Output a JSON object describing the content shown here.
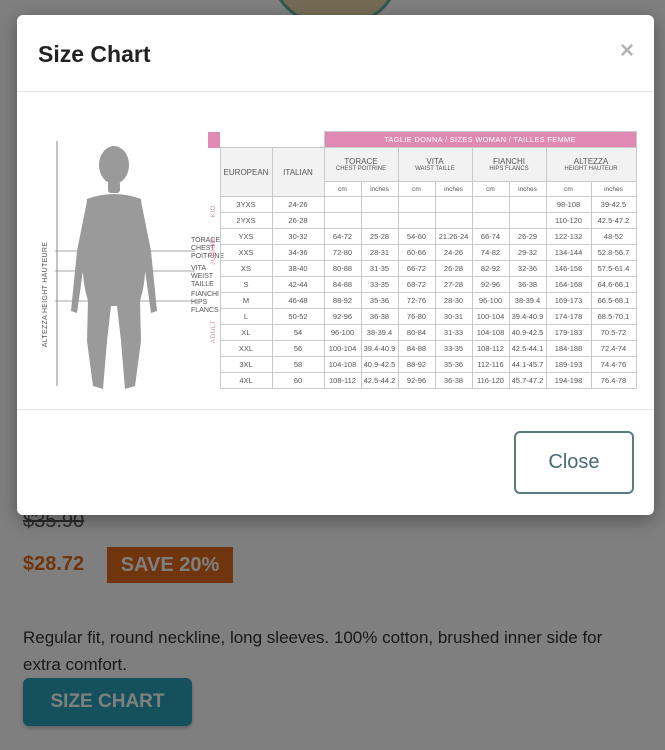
{
  "background": {
    "old_price": "$35.90",
    "new_price": "$28.72",
    "save_badge": "SAVE 20%",
    "description": "Regular fit, round neckline, long sleeves. 100% cotton, brushed inner side for extra comfort.",
    "size_chart_button": "SIZE CHART"
  },
  "modal": {
    "title": "Size Chart",
    "close_icon": "×",
    "close_button": "Close"
  },
  "chart": {
    "table_title": "TAGLIE  DONNA  / SIZES WOMAN / TAILLES FEMME",
    "altezza_label": "ALTEZZA HEIGHT HAUTEURE",
    "body_labels": {
      "torace": [
        "TORACE",
        "CHEST",
        "POITRINE"
      ],
      "vita": [
        "VITA",
        "WEIST",
        "TAILLE"
      ],
      "fianchi": [
        "FIANCHI",
        "HIPS",
        "FLANCS"
      ]
    },
    "headers": {
      "european": "EUROPEAN",
      "italian": "ITALIAN",
      "torace": "TORACE",
      "torace_sub": "CHEST\nPOITRINE",
      "vita": "VITA",
      "vita_sub": "WAIST\nTAILLE",
      "fianchi": "FIANCHI",
      "fianchi_sub": "HIPS\nFLANCS",
      "altezza": "ALTEZZA",
      "altezza_sub": "HEIGHT HAUTEUR",
      "cm": "cm",
      "inches": "inches"
    },
    "groups": {
      "kid": "KID",
      "junior": "JUNIOR",
      "adult": "ADULT"
    },
    "rows_kid": [
      [
        "3YXS",
        "24-26",
        "",
        "",
        "",
        "",
        "",
        "",
        "98-108",
        "39-42.5"
      ],
      [
        "2YXS",
        "26-28",
        "",
        "",
        "",
        "",
        "",
        "",
        "110-120",
        "42.5-47.2"
      ]
    ],
    "rows_junior": [
      [
        "YXS",
        "30-32",
        "64-72",
        "25-28",
        "54-60",
        "21.26-24",
        "66-74",
        "26-29",
        "122-132",
        "48-52"
      ],
      [
        "XXS",
        "34-36",
        "72-80",
        "28-31",
        "60-66",
        "24-26",
        "74-82",
        "29-32",
        "134-144",
        "52.8-56.7"
      ],
      [
        "XS",
        "38-40",
        "80-88",
        "31-35",
        "66-72",
        "26-28",
        "82-92",
        "32-36",
        "146-156",
        "57.5-61.4"
      ]
    ],
    "rows_adult": [
      [
        "S",
        "42-44",
        "84-88",
        "33-35",
        "68-72",
        "27-28",
        "92-96",
        "36-38",
        "164-168",
        "64.6-66.1"
      ],
      [
        "M",
        "46-48",
        "88-92",
        "35-36",
        "72-76",
        "28-30",
        "96-100",
        "38-39.4",
        "169-173",
        "66.5-68.1"
      ],
      [
        "L",
        "50-52",
        "92-96",
        "36-38",
        "76-80",
        "30-31",
        "100-104",
        "39.4-40.9",
        "174-178",
        "68.5-70.1"
      ],
      [
        "XL",
        "54",
        "96-100",
        "38-39.4",
        "80-84",
        "31-33",
        "104-108",
        "40.9-42.5",
        "179-183",
        "70.5-72"
      ],
      [
        "XXL",
        "56",
        "100-104",
        "39.4-40.9",
        "84-88",
        "33-35",
        "108-112",
        "42.5-44.1",
        "184-188",
        "72.4-74"
      ],
      [
        "3XL",
        "58",
        "104-108",
        "40.9-42.5",
        "88-92",
        "35-36",
        "112-116",
        "44.1-45.7",
        "189-193",
        "74.4-76"
      ],
      [
        "4XL",
        "60",
        "108-112",
        "42.5-44.2",
        "92-96",
        "36-38",
        "116-120",
        "45.7-47.2",
        "194-198",
        "76.4-78"
      ]
    ]
  }
}
